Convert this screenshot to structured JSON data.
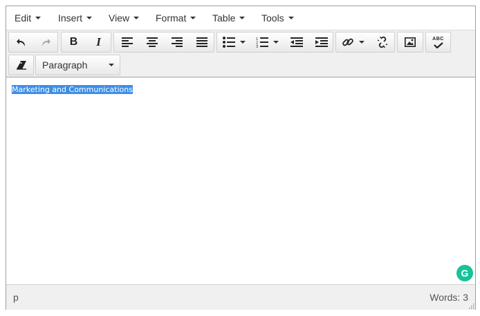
{
  "menubar": {
    "items": [
      {
        "label": "Edit"
      },
      {
        "label": "Insert"
      },
      {
        "label": "View"
      },
      {
        "label": "Format"
      },
      {
        "label": "Table"
      },
      {
        "label": "Tools"
      }
    ]
  },
  "toolbar": {
    "undo_icon": "undo-icon",
    "redo_icon": "redo-icon",
    "bold_label": "B",
    "italic_label": "I",
    "spellcheck_label": "ABC",
    "format_select_value": "Paragraph"
  },
  "content": {
    "paragraph": "Marketing and Communications"
  },
  "statusbar": {
    "path": "p",
    "word_count": "Words: 3"
  },
  "colors": {
    "selection": "#3d8ee6",
    "grammarly": "#15c39a"
  }
}
